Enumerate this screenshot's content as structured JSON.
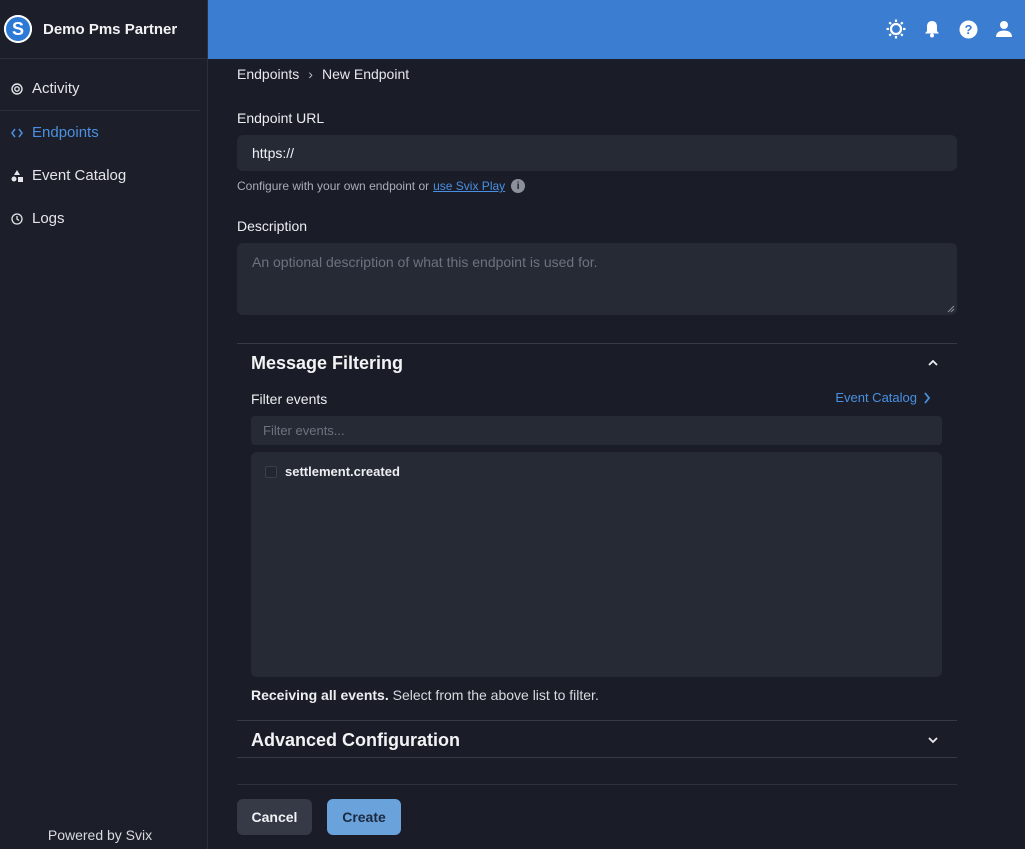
{
  "app": {
    "brand_name": "Demo Pms Partner",
    "logo_letter": "S",
    "powered_by": "Powered by Svix"
  },
  "sidebar": {
    "items": [
      {
        "label": "Activity",
        "icon": "activity-icon",
        "active": false
      },
      {
        "label": "Endpoints",
        "icon": "code-icon",
        "active": true
      },
      {
        "label": "Event Catalog",
        "icon": "shapes-icon",
        "active": false
      },
      {
        "label": "Logs",
        "icon": "history-icon",
        "active": false
      }
    ]
  },
  "topbar": {
    "icons": [
      "theme-toggle-icon",
      "bell-icon",
      "help-icon",
      "user-icon"
    ]
  },
  "breadcrumb": {
    "parent": "Endpoints",
    "separator": "›",
    "current": "New Endpoint"
  },
  "form": {
    "url_label": "Endpoint URL",
    "url_value": "https://",
    "helper_text": "Configure with your own endpoint or",
    "helper_link": "use Svix Play",
    "description_label": "Description",
    "description_placeholder": "An optional description of what this endpoint is used for."
  },
  "message_filtering": {
    "title": "Message Filtering",
    "filter_label": "Filter events",
    "catalog_link": "Event Catalog",
    "filter_placeholder": "Filter events...",
    "events": [
      "settlement.created"
    ],
    "receiving_bold": "Receiving all events.",
    "receiving_rest": "Select from the above list to filter."
  },
  "advanced": {
    "title": "Advanced Configuration"
  },
  "actions": {
    "cancel": "Cancel",
    "create": "Create"
  },
  "colors": {
    "accent": "#4a90e2",
    "topbar": "#3b7dd0",
    "background": "#1a1d27",
    "input_bg": "#262a35",
    "create_button": "#6aa2dc"
  }
}
